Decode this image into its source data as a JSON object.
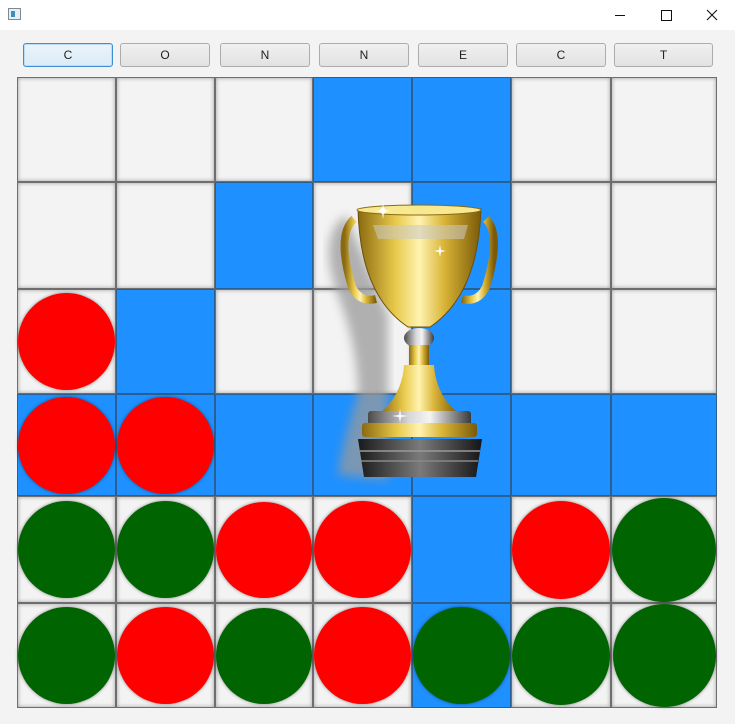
{
  "window": {
    "icon": "app-window-icon"
  },
  "colors": {
    "red": "#ff0000",
    "green": "#006400",
    "highlight": "#1e90ff",
    "cell": "#f3f3f3"
  },
  "toolbar": {
    "buttons": [
      "C",
      "O",
      "N",
      "N",
      "E",
      "C",
      "T"
    ],
    "focused_index": 0
  },
  "board": {
    "columns": 7,
    "rows": 6,
    "cells": [
      [
        "empty",
        "empty",
        "empty",
        "empty",
        "empty",
        "empty",
        "empty"
      ],
      [
        "empty",
        "empty",
        "empty",
        "empty",
        "empty",
        "empty",
        "empty"
      ],
      [
        "red",
        "empty",
        "empty",
        "empty",
        "empty",
        "empty",
        "empty"
      ],
      [
        "red",
        "red",
        "empty",
        "empty",
        "empty",
        "empty",
        "empty"
      ],
      [
        "green",
        "green",
        "red",
        "red",
        "empty",
        "red",
        "green"
      ],
      [
        "green",
        "red",
        "green",
        "red",
        "green",
        "green",
        "green"
      ]
    ],
    "highlighted": [
      [
        0,
        3
      ],
      [
        0,
        4
      ],
      [
        1,
        2
      ],
      [
        1,
        4
      ],
      [
        2,
        1
      ],
      [
        2,
        4
      ],
      [
        3,
        0
      ],
      [
        3,
        1
      ],
      [
        3,
        2
      ],
      [
        3,
        3
      ],
      [
        3,
        4
      ],
      [
        3,
        5
      ],
      [
        3,
        6
      ],
      [
        4,
        4
      ],
      [
        5,
        4
      ]
    ]
  },
  "overlay": {
    "icon": "trophy-icon"
  }
}
